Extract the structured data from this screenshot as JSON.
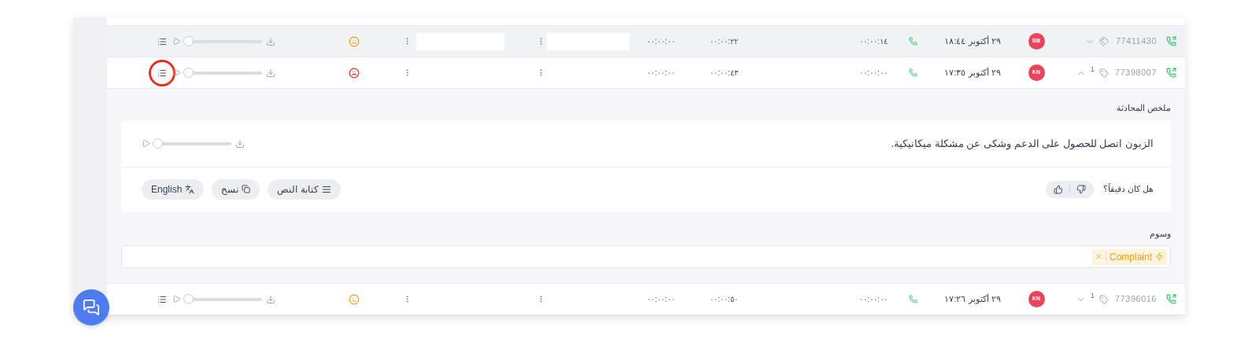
{
  "calls": [
    {
      "number": "77411430",
      "has_tags": false,
      "expanded": false,
      "avatar": "BB",
      "date": "٢٩ أكتوبر ١٨:٤٤",
      "duration_1": "٠٠:٠٠:١٤",
      "duration_2": "٠٠:٠٠:٢٢",
      "duration_3": "٠٠:٠٠:٠٠",
      "sentiment": {
        "kind": "neutral"
      },
      "level": 0,
      "transcript_highlighted": false,
      "hovered": true
    },
    {
      "number": "77398007",
      "has_tags": true,
      "tag_count": "1",
      "expanded": true,
      "avatar": "KN",
      "date": "٢٩ أكتوبر ١٧:٣٥",
      "duration_1": "٠٠:٠٠:٠٠",
      "duration_2": "٠٠:٠٠:٤٣",
      "duration_3": "٠٠:٠٠:٠٠",
      "sentiment": {
        "kind": "negative"
      },
      "level": 0,
      "transcript_highlighted": true,
      "hovered": false,
      "details": {
        "summary_title": "ملخص المحادثة",
        "summary": "الزبون اتصل للحصول على الدعم وشكى عن مشكلة ميكانيكية.",
        "level": 0,
        "feedback_question": "هل كان دقيقاً؟",
        "actions": [
          {
            "kind": "transcript",
            "label": "كتابة النص"
          },
          {
            "kind": "copy",
            "label": "نسخ"
          },
          {
            "kind": "translate",
            "label": "English"
          }
        ],
        "tags_title": "وسوم",
        "tags": [
          {
            "label": "Complaint",
            "color": "#f59e0b"
          }
        ]
      }
    },
    {
      "number": "77396016",
      "has_tags": true,
      "tag_count": "1",
      "expanded": false,
      "avatar": "KN",
      "date": "٢٩ أكتوبر ١٧:٢٦",
      "duration_1": "٠٠:٠٠:٠٠",
      "duration_2": "٠٠:٠٠:٥٠",
      "duration_3": "٠٠:٠٠:٠٠",
      "sentiment": {
        "kind": "neutral"
      },
      "level": 0,
      "transcript_highlighted": false,
      "hovered": false
    }
  ]
}
